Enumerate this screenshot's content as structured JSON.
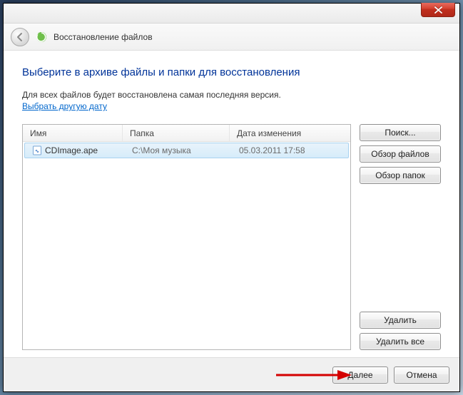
{
  "window": {
    "title": "Восстановление файлов"
  },
  "content": {
    "heading": "Выберите в архиве файлы и папки для восстановления",
    "subtext": "Для всех файлов будет восстановлена самая последняя версия.",
    "link": "Выбрать другую дату"
  },
  "list": {
    "columns": {
      "name": "Имя",
      "folder": "Папка",
      "date": "Дата изменения"
    },
    "rows": [
      {
        "name": "CDImage.ape",
        "folder": "C:\\Моя музыка",
        "date": "05.03.2011 17:58",
        "selected": true
      }
    ]
  },
  "buttons": {
    "search": "Поиск...",
    "browse_files": "Обзор файлов",
    "browse_folders": "Обзор папок",
    "remove": "Удалить",
    "remove_all": "Удалить все",
    "next": "Далее",
    "cancel": "Отмена"
  }
}
